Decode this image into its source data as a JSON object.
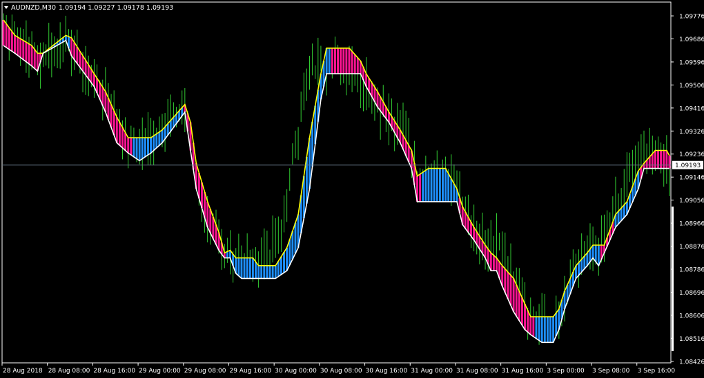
{
  "header": {
    "symbol_label": "AUDNZD,M30",
    "quote_values": "1.09194 1.09227 1.09178 1.09193"
  },
  "colors": {
    "background": "#000000",
    "frame": "#ffffff",
    "candles": "#32cd32",
    "bull_cloud": "#1e90ff",
    "bear_cloud": "#ff1493",
    "upper_band": "#ffff00",
    "lower_band": "#ffffff",
    "bid_line": "#6b7b8c",
    "price_tag_bg": "#ffffff",
    "price_tag_text": "#000000"
  },
  "current_price": {
    "label": "1.09193",
    "value": 1.09193
  },
  "chart_data": {
    "type": "line",
    "title": "",
    "xlabel": "",
    "ylabel": "",
    "ylim": [
      1.0842,
      1.0983
    ],
    "y_ticks": [
      "1.09776",
      "1.09686",
      "1.09596",
      "1.09506",
      "1.09416",
      "1.09326",
      "1.09236",
      "1.09146",
      "1.09056",
      "1.08966",
      "1.08876",
      "1.08786",
      "1.08696",
      "1.08606",
      "1.08516",
      "1.08426"
    ],
    "x_ticks": [
      "28 Aug 2018",
      "28 Aug 08:00",
      "28 Aug 16:00",
      "29 Aug 00:00",
      "29 Aug 08:00",
      "29 Aug 16:00",
      "30 Aug 00:00",
      "30 Aug 08:00",
      "30 Aug 16:00",
      "31 Aug 00:00",
      "31 Aug 08:00",
      "31 Aug 16:00",
      "3 Sep 00:00",
      "3 Sep 08:00",
      "3 Sep 16:00"
    ],
    "x_tick_index": [
      0,
      16,
      32,
      48,
      64,
      80,
      96,
      112,
      128,
      144,
      160,
      176,
      192,
      208,
      224
    ],
    "bars_visible": 236,
    "price_path": [
      [
        0,
        1.0973
      ],
      [
        6,
        1.0967
      ],
      [
        12,
        1.0962
      ],
      [
        17,
        1.0964
      ],
      [
        22,
        1.0968
      ],
      [
        26,
        1.0962
      ],
      [
        30,
        1.0955
      ],
      [
        36,
        1.0948
      ],
      [
        40,
        1.0938
      ],
      [
        44,
        1.0926
      ],
      [
        48,
        1.0927
      ],
      [
        54,
        1.0932
      ],
      [
        60,
        1.0939
      ],
      [
        64,
        1.0943
      ],
      [
        66,
        1.0928
      ],
      [
        70,
        1.0905
      ],
      [
        74,
        1.0892
      ],
      [
        78,
        1.0884
      ],
      [
        82,
        1.0885
      ],
      [
        88,
        1.0882
      ],
      [
        94,
        1.0884
      ],
      [
        98,
        1.0894
      ],
      [
        102,
        1.092
      ],
      [
        106,
        1.095
      ],
      [
        112,
        1.096
      ],
      [
        118,
        1.096
      ],
      [
        124,
        1.0955
      ],
      [
        130,
        1.0946
      ],
      [
        136,
        1.0938
      ],
      [
        142,
        1.0932
      ],
      [
        146,
        1.0912
      ],
      [
        150,
        1.0918
      ],
      [
        156,
        1.0918
      ],
      [
        162,
        1.0905
      ],
      [
        166,
        1.0893
      ],
      [
        170,
        1.0886
      ],
      [
        174,
        1.0888
      ],
      [
        178,
        1.088
      ],
      [
        182,
        1.087
      ],
      [
        186,
        1.0858
      ],
      [
        190,
        1.086
      ],
      [
        194,
        1.0855
      ],
      [
        198,
        1.0867
      ],
      [
        202,
        1.088
      ],
      [
        206,
        1.0888
      ],
      [
        210,
        1.0888
      ],
      [
        216,
        1.0903
      ],
      [
        222,
        1.0918
      ],
      [
        226,
        1.0925
      ],
      [
        230,
        1.0924
      ],
      [
        235,
        1.0919
      ]
    ],
    "band_keys": [
      [
        0,
        1.0976,
        1.0966
      ],
      [
        4,
        1.097,
        1.0963
      ],
      [
        10,
        1.0966,
        1.0958
      ],
      [
        12,
        1.0963,
        1.0956
      ],
      [
        14,
        1.0963,
        1.0963
      ],
      [
        22,
        1.097,
        1.0968
      ],
      [
        24,
        1.0969,
        1.0962
      ],
      [
        28,
        1.0962,
        1.0956
      ],
      [
        32,
        1.0955,
        1.095
      ],
      [
        36,
        1.0948,
        1.094
      ],
      [
        40,
        1.0938,
        1.0928
      ],
      [
        44,
        1.093,
        1.0924
      ],
      [
        48,
        1.093,
        1.0921
      ],
      [
        52,
        1.093,
        1.0924
      ],
      [
        56,
        1.0933,
        1.0928
      ],
      [
        60,
        1.0938,
        1.0934
      ],
      [
        64,
        1.0943,
        1.094
      ],
      [
        66,
        1.0936,
        1.0925
      ],
      [
        68,
        1.092,
        1.091
      ],
      [
        72,
        1.0905,
        1.0895
      ],
      [
        76,
        1.0893,
        1.0886
      ],
      [
        78,
        1.0885,
        1.0883
      ],
      [
        80,
        1.0886,
        1.0883
      ],
      [
        82,
        1.0883,
        1.0877
      ],
      [
        84,
        1.0883,
        1.0875
      ],
      [
        88,
        1.0883,
        1.0875
      ],
      [
        90,
        1.088,
        1.0875
      ],
      [
        96,
        1.088,
        1.0875
      ],
      [
        100,
        1.0887,
        1.0878
      ],
      [
        104,
        1.09,
        1.0887
      ],
      [
        108,
        1.093,
        1.091
      ],
      [
        112,
        1.0955,
        1.0945
      ],
      [
        114,
        1.0965,
        1.0955
      ],
      [
        118,
        1.0965,
        1.0955
      ],
      [
        122,
        1.0965,
        1.0955
      ],
      [
        126,
        1.096,
        1.0955
      ],
      [
        128,
        1.0955,
        1.095
      ],
      [
        132,
        1.0948,
        1.0942
      ],
      [
        136,
        1.094,
        1.0936
      ],
      [
        140,
        1.0933,
        1.0928
      ],
      [
        144,
        1.0925,
        1.0918
      ],
      [
        146,
        1.0915,
        1.0905
      ],
      [
        150,
        1.0918,
        1.0905
      ],
      [
        156,
        1.0918,
        1.0905
      ],
      [
        160,
        1.091,
        1.0905
      ],
      [
        162,
        1.0903,
        1.0896
      ],
      [
        166,
        1.0895,
        1.089
      ],
      [
        170,
        1.0888,
        1.0883
      ],
      [
        172,
        1.0885,
        1.0878
      ],
      [
        174,
        1.0883,
        1.0878
      ],
      [
        176,
        1.088,
        1.0872
      ],
      [
        180,
        1.0875,
        1.0862
      ],
      [
        184,
        1.0865,
        1.0855
      ],
      [
        186,
        1.086,
        1.0853
      ],
      [
        190,
        1.086,
        1.085
      ],
      [
        194,
        1.086,
        1.085
      ],
      [
        196,
        1.0863,
        1.0855
      ],
      [
        198,
        1.087,
        1.0863
      ],
      [
        202,
        1.088,
        1.0875
      ],
      [
        206,
        1.0885,
        1.088
      ],
      [
        208,
        1.0888,
        1.0883
      ],
      [
        210,
        1.0888,
        1.088
      ],
      [
        212,
        1.0888,
        1.0885
      ],
      [
        216,
        1.09,
        1.0895
      ],
      [
        220,
        1.0905,
        1.09
      ],
      [
        224,
        1.0917,
        1.091
      ],
      [
        226,
        1.092,
        1.0918
      ],
      [
        230,
        1.0925,
        1.0918
      ],
      [
        234,
        1.0925,
        1.0918
      ],
      [
        235,
        1.0923,
        1.0918
      ]
    ],
    "trend_segments": [
      [
        0,
        13,
        "bear"
      ],
      [
        14,
        23,
        "bull"
      ],
      [
        24,
        45,
        "bear"
      ],
      [
        46,
        63,
        "bull"
      ],
      [
        64,
        78,
        "bear"
      ],
      [
        79,
        103,
        "bull"
      ],
      [
        104,
        115,
        "bull"
      ],
      [
        116,
        147,
        "bear"
      ],
      [
        148,
        160,
        "bull"
      ],
      [
        161,
        187,
        "bear"
      ],
      [
        188,
        210,
        "bull"
      ],
      [
        211,
        215,
        "bear"
      ],
      [
        216,
        224,
        "bull"
      ],
      [
        225,
        235,
        "bear"
      ]
    ]
  }
}
